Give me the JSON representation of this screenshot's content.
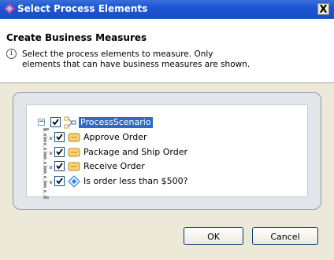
{
  "window": {
    "title": "Select Process Elements",
    "close_glyph": "X"
  },
  "header": {
    "title": "Create Business Measures",
    "info_lines": [
      "Select the process elements to measure. Only",
      "elements that can have business measures are shown."
    ]
  },
  "tree": {
    "root": {
      "label": "ProcessScenario",
      "checked": true,
      "expanded": true
    },
    "children": [
      {
        "label": "Approve Order",
        "checked": true,
        "icon": "task-icon"
      },
      {
        "label": "Package and Ship Order",
        "checked": true,
        "icon": "task-icon"
      },
      {
        "label": "Receive Order",
        "checked": true,
        "icon": "task-icon"
      },
      {
        "label": "Is order less than  $500?",
        "checked": true,
        "icon": "decision-icon"
      }
    ]
  },
  "buttons": {
    "ok": "OK",
    "cancel": "Cancel"
  },
  "colors": {
    "titlebar": "#1c55d6",
    "selection": "#316ac5",
    "dialog_bg": "#ece9d8"
  }
}
